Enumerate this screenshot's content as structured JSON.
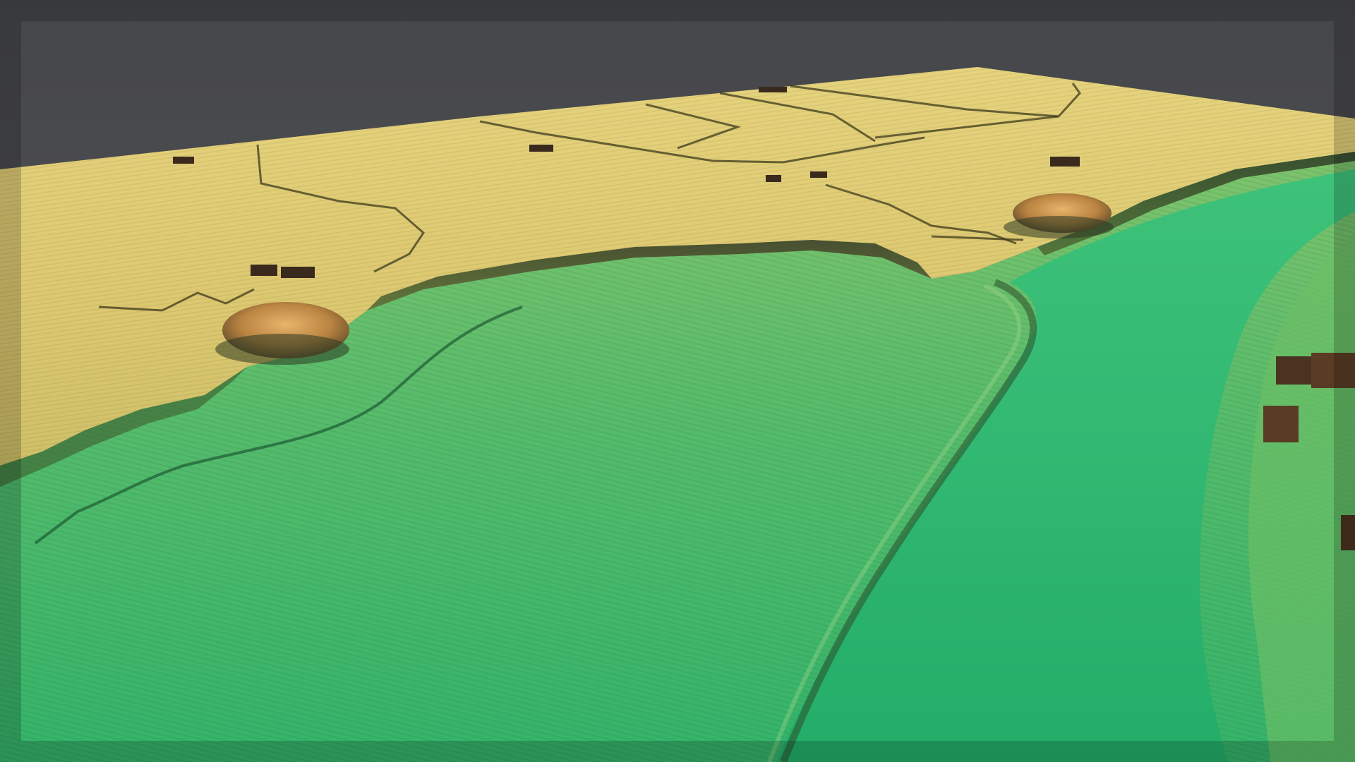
{
  "scene": {
    "kind": "lidar-terrain-render",
    "elevation_ramp": {
      "low": "#2fb46a",
      "mid": "#7cc46a",
      "high": "#e2cf77",
      "peak": "#c98a45"
    },
    "background": "#505155"
  }
}
